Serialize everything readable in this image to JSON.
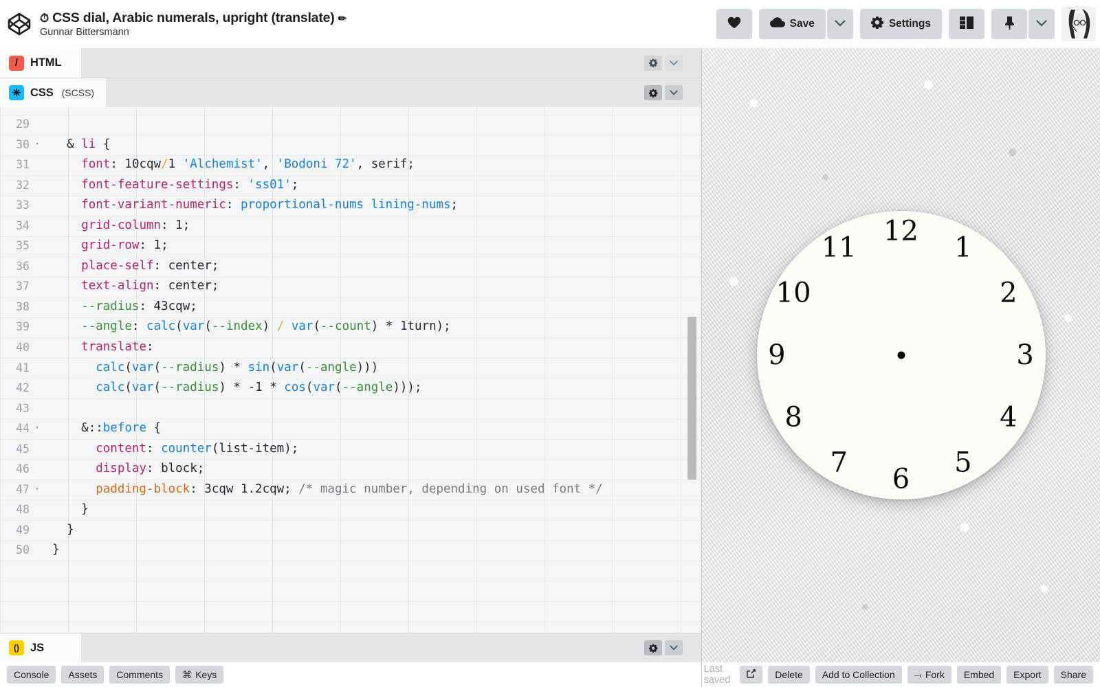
{
  "header": {
    "logo_icon": "codepen-logo-icon",
    "stopwatch_icon": "⏱",
    "pen_title": "CSS dial, Arabic numerals, upright (translate)",
    "pencil_icon": "✏",
    "author": "Gunnar Bittersmann",
    "buttons": {
      "love_label": "",
      "love_icon": "heart-icon",
      "save_label": "Save",
      "save_icon": "cloud-icon",
      "save_caret": "⌄",
      "settings_label": "Settings",
      "settings_icon": "gear-icon",
      "layout_icon": "layout-panels-icon",
      "pin_icon": "pin-icon",
      "pin_caret": "⌄",
      "avatar_alt": "user-avatar"
    }
  },
  "panes": {
    "html": {
      "label": "HTML",
      "sub": "",
      "icon_glyph": "/"
    },
    "css": {
      "label": "CSS",
      "sub": "(SCSS)",
      "icon_glyph": "✳"
    },
    "js": {
      "label": "JS",
      "sub": "",
      "icon_glyph": "()"
    }
  },
  "editor": {
    "first_line_number": 29,
    "last_line_number": 50,
    "lines": [
      {
        "n": "29",
        "fold": "",
        "text": ""
      },
      {
        "n": "30",
        "fold": "▾",
        "text": "  & li {"
      },
      {
        "n": "31",
        "fold": "",
        "text": "    font: 10cqw/1 'Alchemist', 'Bodoni 72', serif;"
      },
      {
        "n": "32",
        "fold": "",
        "text": "    font-feature-settings: 'ss01';"
      },
      {
        "n": "33",
        "fold": "",
        "text": "    font-variant-numeric: proportional-nums lining-nums;"
      },
      {
        "n": "34",
        "fold": "",
        "text": "    grid-column: 1;"
      },
      {
        "n": "35",
        "fold": "",
        "text": "    grid-row: 1;"
      },
      {
        "n": "36",
        "fold": "",
        "text": "    place-self: center;"
      },
      {
        "n": "37",
        "fold": "",
        "text": "    text-align: center;"
      },
      {
        "n": "38",
        "fold": "",
        "text": "    --radius: 43cqw;"
      },
      {
        "n": "39",
        "fold": "",
        "text": "    --angle: calc(var(--index) / var(--count) * 1turn);"
      },
      {
        "n": "40",
        "fold": "",
        "text": "    translate:"
      },
      {
        "n": "41",
        "fold": "",
        "text": "      calc(var(--radius) * sin(var(--angle)))"
      },
      {
        "n": "42",
        "fold": "",
        "text": "      calc(var(--radius) * -1 * cos(var(--angle)));"
      },
      {
        "n": "43",
        "fold": "",
        "text": ""
      },
      {
        "n": "44",
        "fold": "▾",
        "text": "    &::before {"
      },
      {
        "n": "45",
        "fold": "",
        "text": "      content: counter(list-item);"
      },
      {
        "n": "46",
        "fold": "",
        "text": "      display: block;"
      },
      {
        "n": "47",
        "fold": "▾",
        "text": "      padding-block: 3cqw 1.2cqw; /* magic number, depending on used font */"
      },
      {
        "n": "48",
        "fold": "",
        "text": "    }"
      },
      {
        "n": "49",
        "fold": "",
        "text": "  }"
      },
      {
        "n": "50",
        "fold": "",
        "text": "}"
      }
    ]
  },
  "bottom_bar": {
    "buttons": [
      "Console",
      "Assets",
      "Comments"
    ],
    "keys_label": "Keys",
    "keys_icon": "⌘"
  },
  "status_bar": {
    "last_saved": "Last saved",
    "open_external_icon": "external-link-icon",
    "buttons": [
      "Delete",
      "Add to Collection",
      "Fork",
      "Embed",
      "Export",
      "Share"
    ],
    "fork_icon": "⤙"
  },
  "preview": {
    "clock": {
      "numerals": [
        "1",
        "2",
        "3",
        "4",
        "5",
        "6",
        "7",
        "8",
        "9",
        "10",
        "11",
        "12"
      ],
      "center_dot": true,
      "face_color": "#fdfbf6",
      "numeral_color": "#0b0b0b",
      "radius_percent": 43
    },
    "background": "textured stucco wall, light gray"
  },
  "colors": {
    "html_accent": "#f7584c",
    "css_accent": "#19b9ff",
    "js_accent": "#fcd000",
    "button_bg": "#d5d8dc",
    "editor_bg": "#f4f5f6",
    "chrome_bg": "#e3e5e7"
  }
}
